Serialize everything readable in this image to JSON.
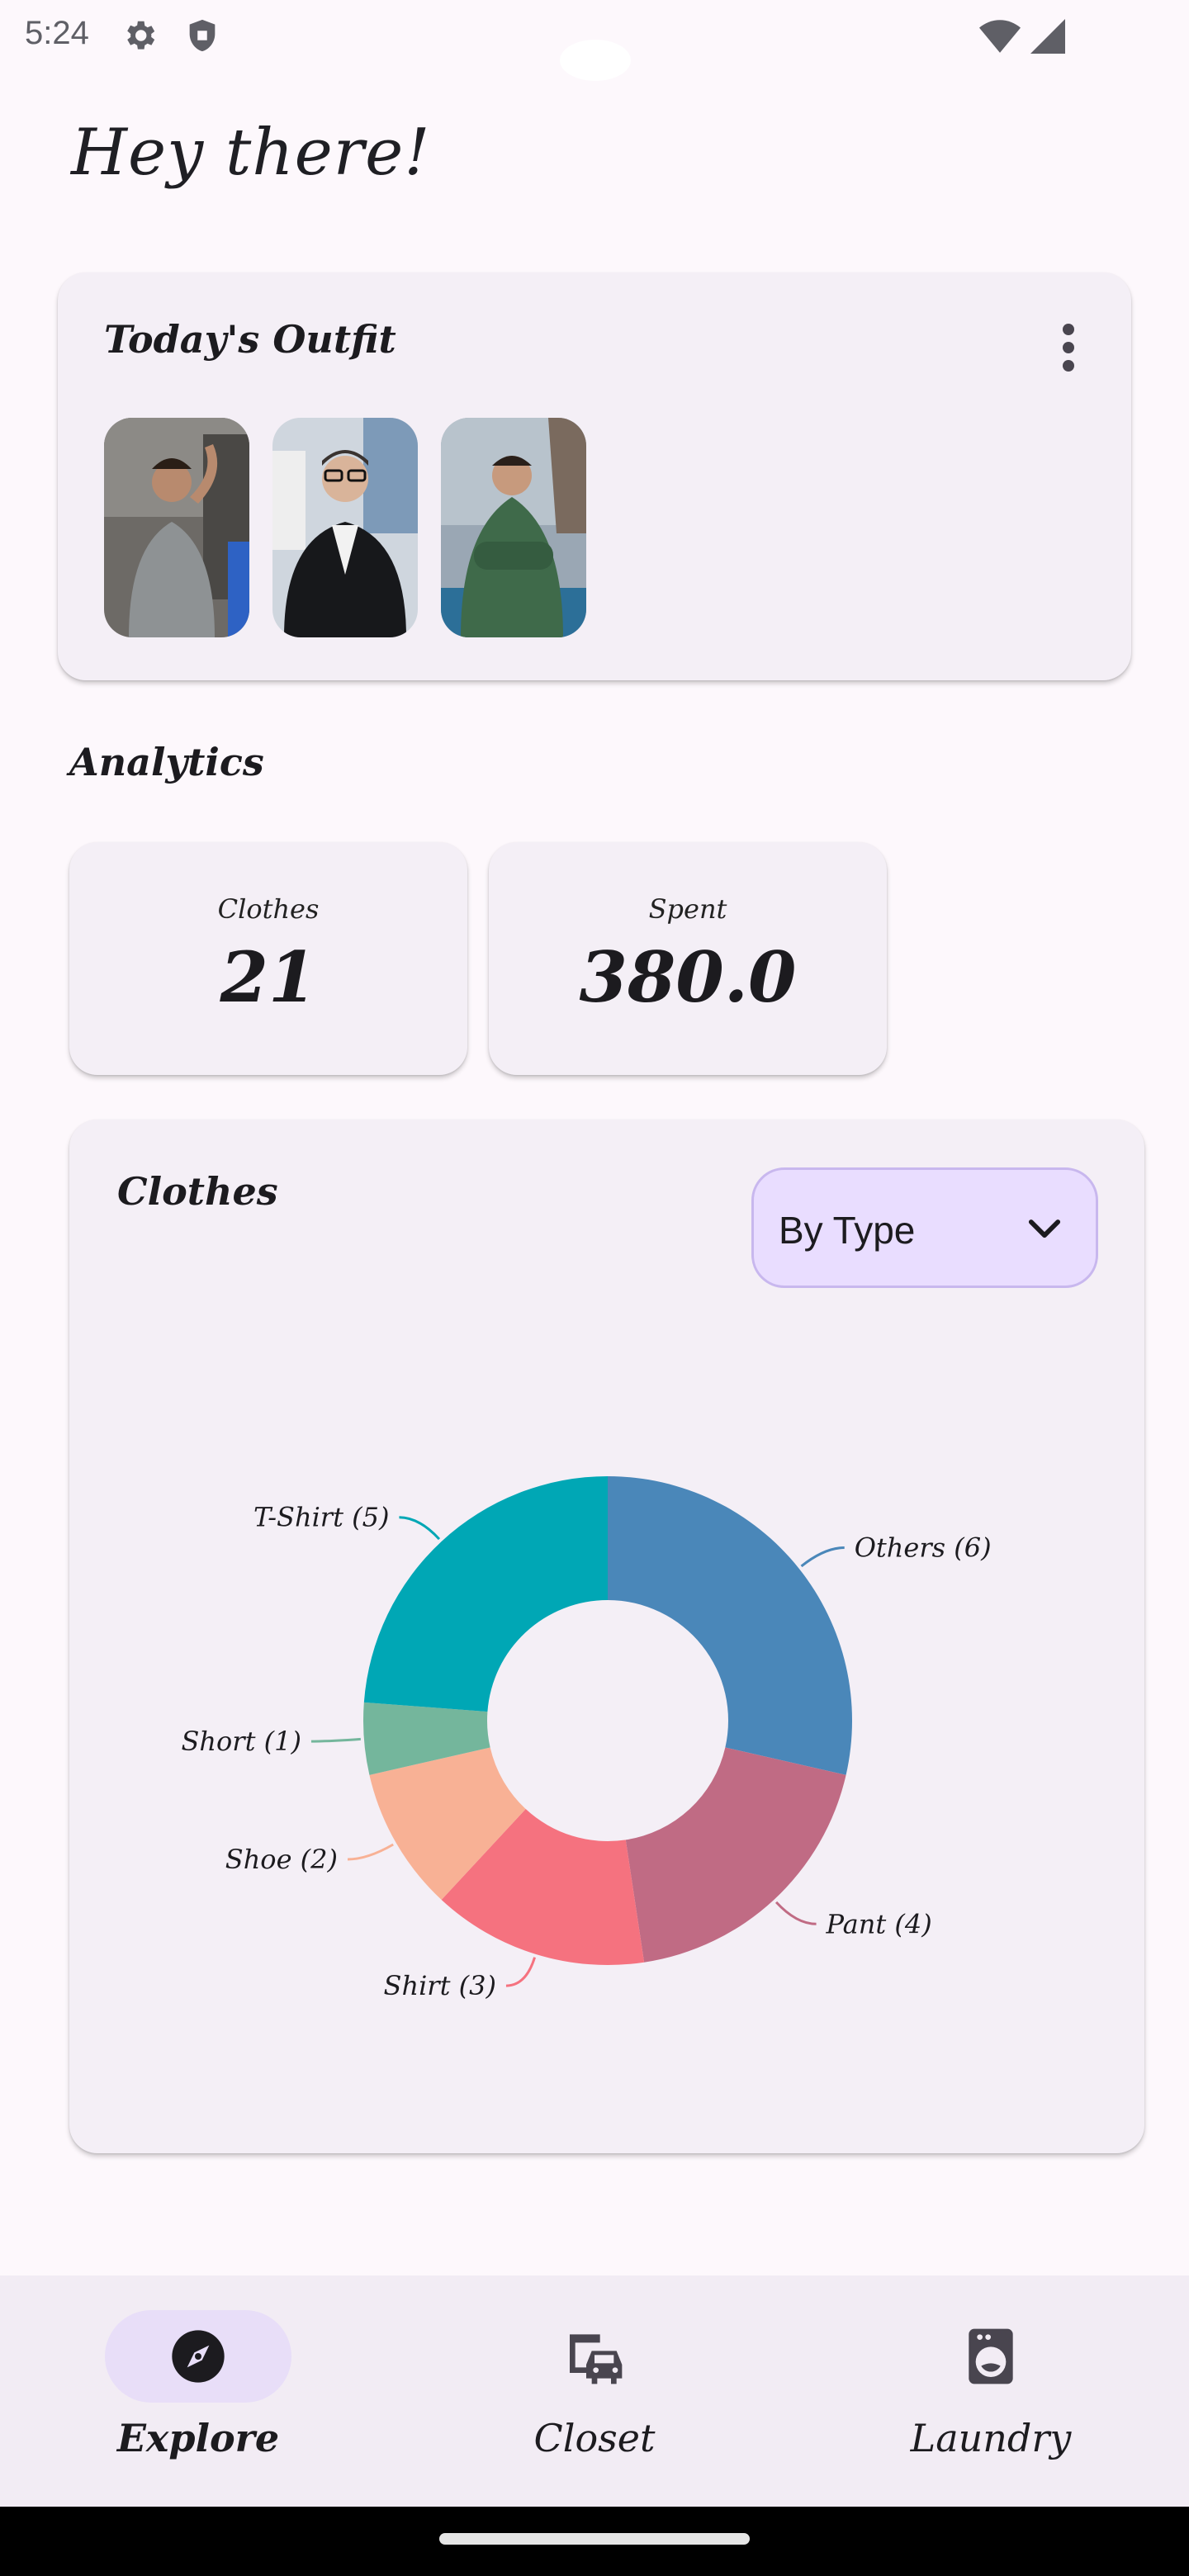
{
  "status_bar": {
    "time": "5:24",
    "icons": [
      "gear-icon",
      "shield-icon",
      "wifi-icon",
      "signal-icon"
    ]
  },
  "greeting": "Hey there!",
  "outfit_card": {
    "title": "Today's Outfit",
    "menu_icon": "more-vert-icon",
    "photos": [
      {
        "name": "outfit-photo-grey-tshirt"
      },
      {
        "name": "outfit-photo-black-blazer"
      },
      {
        "name": "outfit-photo-green-hoodie"
      }
    ]
  },
  "analytics": {
    "title": "Analytics",
    "stats": [
      {
        "label": "Clothes",
        "value": "21"
      },
      {
        "label": "Spent",
        "value": "380.0"
      }
    ]
  },
  "clothes_chart": {
    "title": "Clothes",
    "dropdown": {
      "selected": "By Type",
      "icon": "chevron-down-icon"
    }
  },
  "chart_data": {
    "type": "pie",
    "donut": true,
    "categories": [
      "Others",
      "Pant",
      "Shirt",
      "Shoe",
      "Short",
      "T-Shirt"
    ],
    "values": [
      6,
      4,
      3,
      2,
      1,
      5
    ],
    "labels": [
      "Others (6)",
      "Pant (4)",
      "Shirt (3)",
      "Shoe (2)",
      "Short (1)",
      "T-Shirt (5)"
    ],
    "colors": [
      "#4a87b9",
      "#c06b84",
      "#f5727f",
      "#f8b195",
      "#74b69c",
      "#00a7b5"
    ]
  },
  "bottom_nav": {
    "items": [
      {
        "label": "Explore",
        "icon": "compass-icon",
        "active": true
      },
      {
        "label": "Closet",
        "icon": "closet-icon",
        "active": false
      },
      {
        "label": "Laundry",
        "icon": "washing-machine-icon",
        "active": false
      }
    ]
  },
  "colors": {
    "background": "#fdf8fc",
    "card": "#f4eff6",
    "accent": "#e8def8",
    "dropdown": "#e9ddff"
  }
}
